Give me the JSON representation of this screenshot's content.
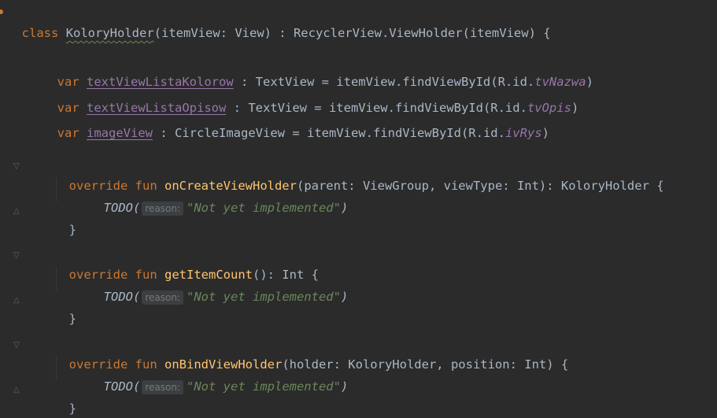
{
  "lines": {
    "l1": {
      "kw": "class",
      "cls": "KoloryHolder",
      "rest": "(itemView: View) : RecyclerView.ViewHolder(itemView) {"
    },
    "l2": {
      "kw": "var",
      "prop": "textViewListaKolorow",
      "mid": " : TextView = itemView.findViewById(R.id.",
      "id": "tvNazwa",
      "end": ")"
    },
    "l3": {
      "kw": "var",
      "prop": "textViewListaOpisow",
      "mid": " : TextView = itemView.findViewById(R.id.",
      "id": "tvOpis",
      "end": ")"
    },
    "l4": {
      "kw": "var",
      "prop": "imageView",
      "mid": " : CircleImageView = itemView.findViewById(R.id.",
      "id": "ivRys",
      "end": ")"
    },
    "f1": {
      "kw": "override fun",
      "fn": "onCreateViewHolder",
      "rest": "(parent: ViewGroup, viewType: Int): KoloryHolder {"
    },
    "f2": {
      "kw": "override fun",
      "fn": "getItemCount",
      "rest": "(): Int {"
    },
    "f3": {
      "kw": "override fun",
      "fn": "onBindViewHolder",
      "rest": "(holder: KoloryHolder, position: Int) {"
    },
    "todo": "TODO(",
    "hint": "reason:",
    "str": "\"Not yet implemented\"",
    "close_paren": ")",
    "close_brace": "}"
  },
  "colors": {
    "background": "#2b2b2b",
    "keyword": "#cc7832",
    "function": "#ffc66d",
    "property": "#9876aa",
    "string": "#6a8759",
    "text": "#a9b7c6"
  }
}
